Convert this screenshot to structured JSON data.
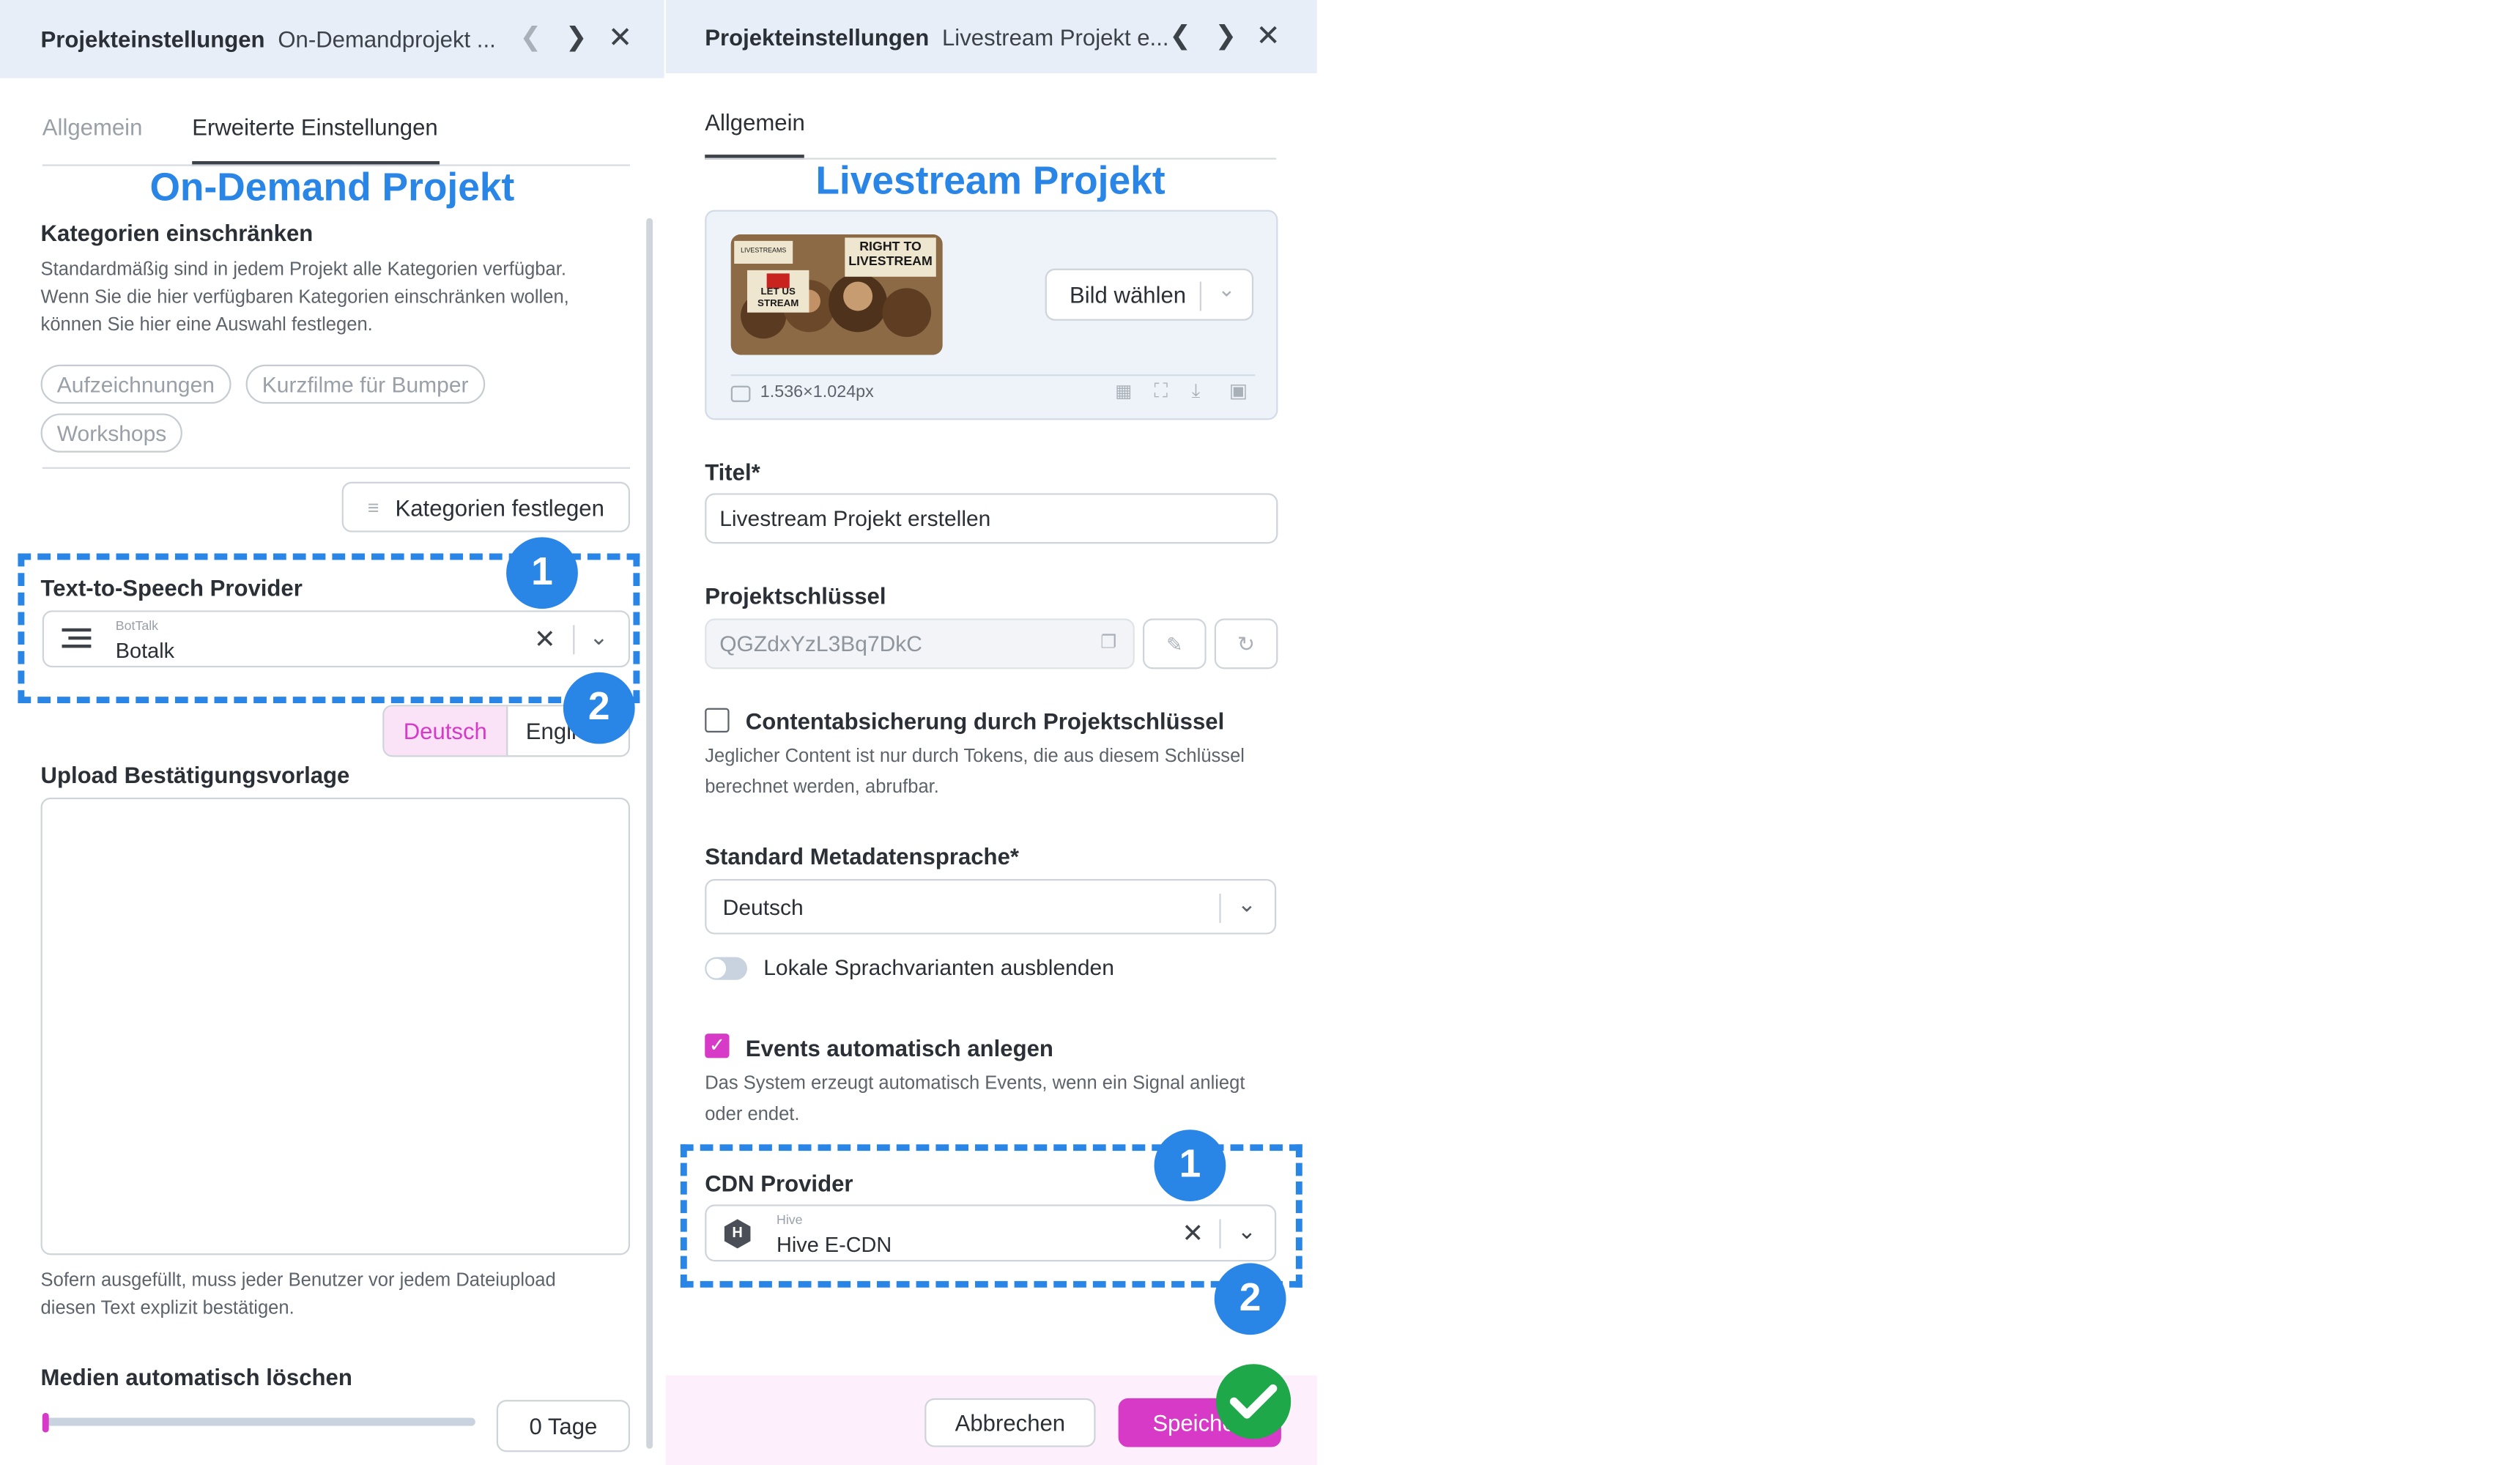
{
  "left": {
    "header": {
      "title": "Projekteinstellungen",
      "subtitle": "On-Demandprojekt ..."
    },
    "tabs": [
      {
        "label": "Allgemein",
        "active": false
      },
      {
        "label": "Erweiterte Einstellungen",
        "active": true
      }
    ],
    "annotation_title": "On-Demand Projekt",
    "categories": {
      "heading": "Kategorien einschränken",
      "help": "Standardmäßig sind in jedem Projekt alle Kategorien verfügbar. Wenn Sie die hier verfügbaren Kategorien einschränken wollen, können Sie hier eine Auswahl festlegen.",
      "chips": [
        "Aufzeichnungen",
        "Kurzfilme für Bumper",
        "Workshops"
      ],
      "button": "Kategorien festlegen"
    },
    "tts": {
      "label": "Text-to-Speech Provider",
      "small": "BotTalk",
      "value": "Botalk",
      "clear_icon": "close-icon",
      "lang_buttons": [
        "Deutsch",
        "Engli"
      ]
    },
    "upload": {
      "label": "Upload Bestätigungsvorlage",
      "value": "",
      "help": "Sofern ausgefüllt, muss jeder Benutzer vor jedem Dateiupload diesen Text explizit bestätigen."
    },
    "media_delete": {
      "label": "Medien automatisch löschen",
      "slider_level": 0,
      "days": "0 Tage"
    }
  },
  "right": {
    "header": {
      "title": "Projekteinstellungen",
      "subtitle": "Livestream Projekt e..."
    },
    "tabs": [
      {
        "label": "Allgemein",
        "active": true
      }
    ],
    "annotation_title": "Livestream Projekt",
    "image": {
      "caption_top": "RIGHT TO LIVESTREAM",
      "caption_sign": "LET US STREAM",
      "caption_small": "LIVESTREAMS",
      "choose_button": "Bild wählen",
      "size": "1.536×1.024px"
    },
    "title_field": {
      "label": "Titel*",
      "value": "Livestream Projekt erstellen"
    },
    "project_key": {
      "label": "Projektschlüssel",
      "value": "QGZdxYzL3Bq7DkC"
    },
    "content_protection": {
      "label": "Contentabsicherung durch Projektschlüssel",
      "checked": false,
      "help": "Jeglicher Content ist nur durch Tokens, die aus diesem Schlüssel berechnet werden, abrufbar."
    },
    "metadata_lang": {
      "label": "Standard Metadatensprache*",
      "value": "Deutsch"
    },
    "hide_variants": {
      "label": "Lokale Sprachvarianten ausblenden",
      "on": false
    },
    "auto_events": {
      "label": "Events automatisch anlegen",
      "checked": true,
      "help": "Das System erzeugt automatisch Events, wenn ein Signal anliegt oder endet."
    },
    "cdn": {
      "label": "CDN Provider",
      "small": "Hive",
      "value": "Hive E-CDN",
      "logo_letter": "H"
    },
    "footer": {
      "cancel": "Abbrechen",
      "save": "Speiche"
    }
  },
  "badges": {
    "one": "1",
    "two": "2"
  },
  "colors": {
    "accent_blue": "#2a86e6",
    "brand_magenta": "#d63ac6",
    "success_green": "#1fa84a",
    "header_bg": "#e8eef7"
  }
}
